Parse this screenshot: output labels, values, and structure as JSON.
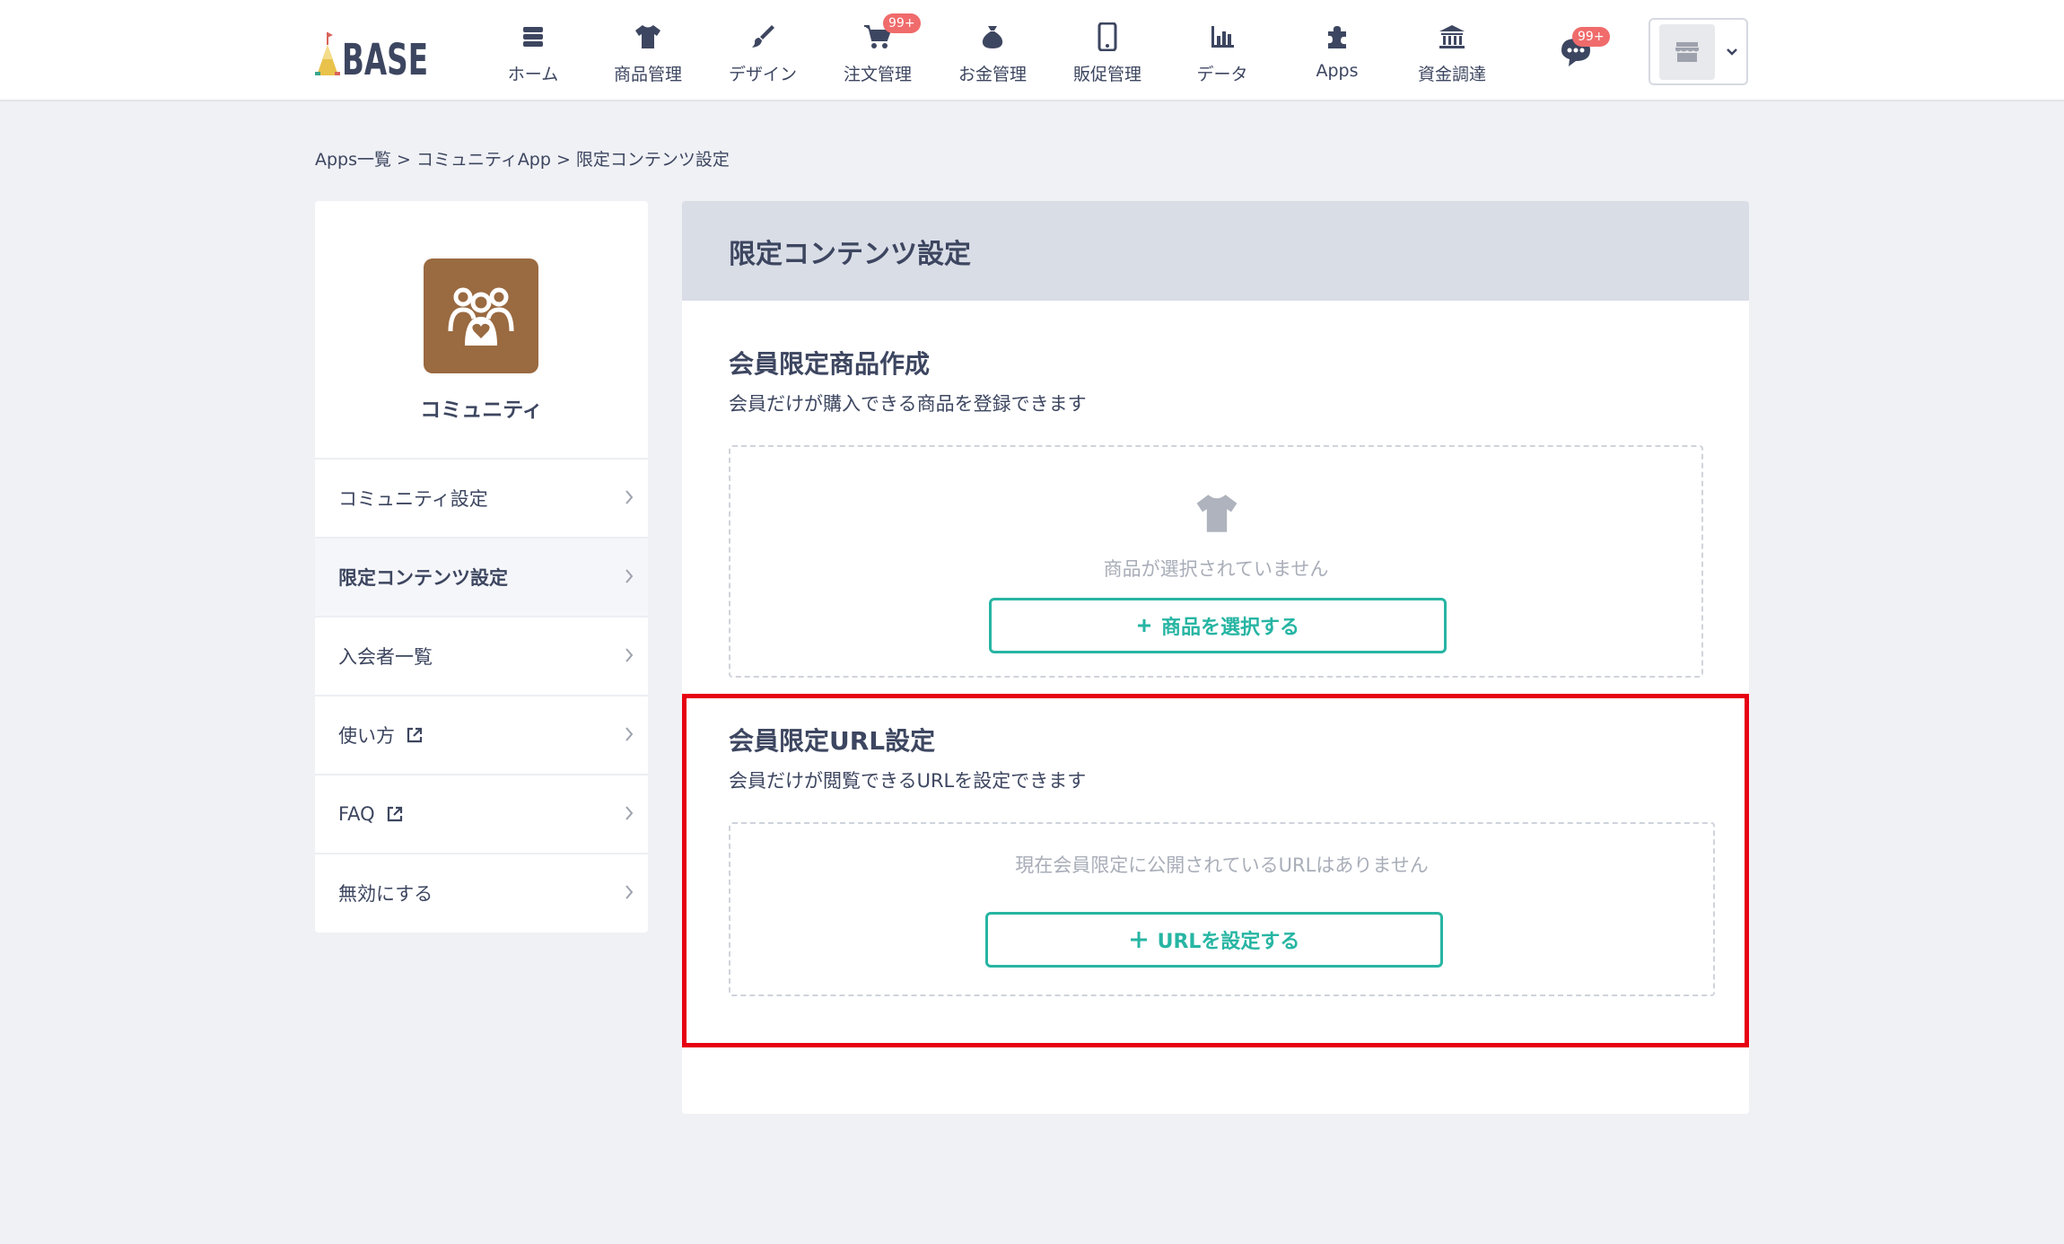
{
  "brand": {
    "logo_text": "BASE"
  },
  "nav": [
    {
      "label": "ホーム",
      "icon": "home-list-icon"
    },
    {
      "label": "商品管理",
      "icon": "tshirt-icon"
    },
    {
      "label": "デザイン",
      "icon": "brush-icon"
    },
    {
      "label": "注文管理",
      "icon": "cart-icon",
      "badge": "99+"
    },
    {
      "label": "お金管理",
      "icon": "money-bag-icon"
    },
    {
      "label": "販促管理",
      "icon": "smartphone-icon"
    },
    {
      "label": "データ",
      "icon": "bar-chart-icon"
    },
    {
      "label": "Apps",
      "icon": "puzzle-icon"
    },
    {
      "label": "資金調達",
      "icon": "bank-icon"
    }
  ],
  "header": {
    "chat_badge": "99+"
  },
  "breadcrumb": {
    "items": [
      "Apps一覧",
      "コミュニティApp",
      "限定コンテンツ設定"
    ],
    "separator": ">"
  },
  "sidebar": {
    "app_name": "コミュニティ",
    "items": [
      {
        "label": "コミュニティ設定",
        "active": false,
        "external": false
      },
      {
        "label": "限定コンテンツ設定",
        "active": true,
        "external": false
      },
      {
        "label": "入会者一覧",
        "active": false,
        "external": false
      },
      {
        "label": "使い方",
        "active": false,
        "external": true
      },
      {
        "label": "FAQ",
        "active": false,
        "external": true
      },
      {
        "label": "無効にする",
        "active": false,
        "external": false
      }
    ]
  },
  "main": {
    "title": "限定コンテンツ設定",
    "products": {
      "title": "会員限定商品作成",
      "description": "会員だけが購入できる商品を登録できます",
      "empty_text": "商品が選択されていません",
      "button_label": "商品を選択する"
    },
    "urls": {
      "title": "会員限定URL設定",
      "description": "会員だけが閲覧できるURLを設定できます",
      "empty_text": "現在会員限定に公開されているURLはありません",
      "button_label": "URLを設定する"
    }
  },
  "colors": {
    "accent": "#27b5a3",
    "badge": "#f06b6b",
    "app_icon_bg": "#9a6a41",
    "highlight": "#e60012",
    "text": "#3d4660"
  }
}
